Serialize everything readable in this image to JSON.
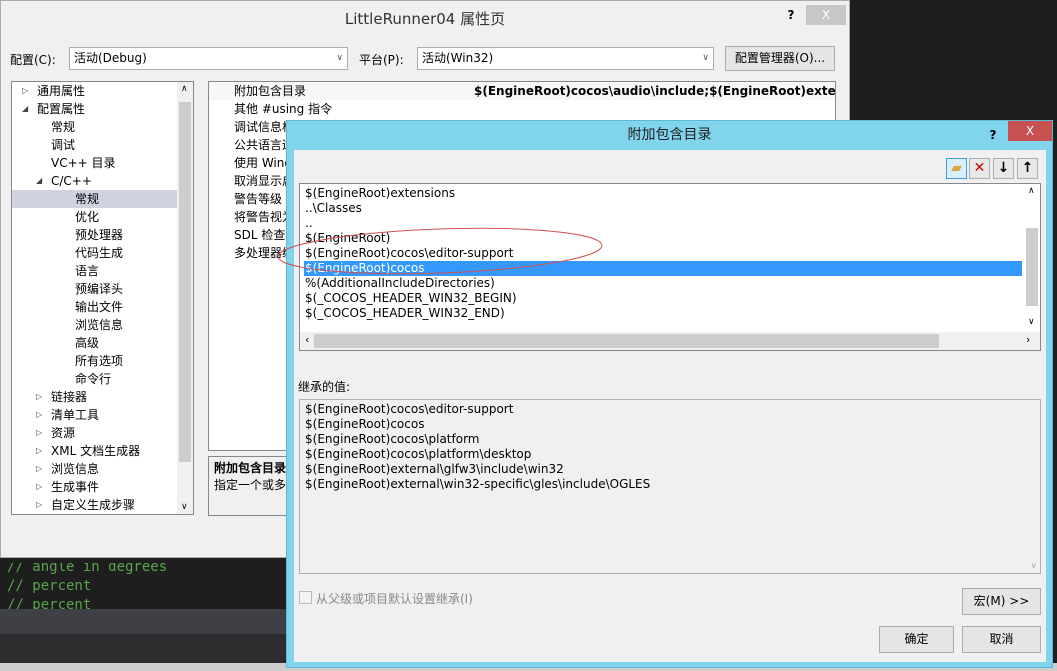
{
  "main": {
    "title": "LittleRunner04 属性页",
    "help": "?",
    "close": "X",
    "config_label": "配置(C):",
    "config_value": "活动(Debug)",
    "platform_label": "平台(P):",
    "platform_value": "活动(Win32)",
    "config_manager": "配置管理器(O)...",
    "tree": [
      {
        "label": "通用属性",
        "level": 0,
        "exp": "▷"
      },
      {
        "label": "配置属性",
        "level": 0,
        "exp": "◢"
      },
      {
        "label": "常规",
        "level": 1
      },
      {
        "label": "调试",
        "level": 1
      },
      {
        "label": "VC++ 目录",
        "level": 1
      },
      {
        "label": "C/C++",
        "level": 1,
        "exp": "◢"
      },
      {
        "label": "常规",
        "level": 2,
        "selected": true
      },
      {
        "label": "优化",
        "level": 2
      },
      {
        "label": "预处理器",
        "level": 2
      },
      {
        "label": "代码生成",
        "level": 2
      },
      {
        "label": "语言",
        "level": 2
      },
      {
        "label": "预编译头",
        "level": 2
      },
      {
        "label": "输出文件",
        "level": 2
      },
      {
        "label": "浏览信息",
        "level": 2
      },
      {
        "label": "高级",
        "level": 2
      },
      {
        "label": "所有选项",
        "level": 2
      },
      {
        "label": "命令行",
        "level": 2
      },
      {
        "label": "链接器",
        "level": 1,
        "exp": "▷"
      },
      {
        "label": "清单工具",
        "level": 1,
        "exp": "▷"
      },
      {
        "label": "资源",
        "level": 1,
        "exp": "▷"
      },
      {
        "label": "XML 文档生成器",
        "level": 1,
        "exp": "▷"
      },
      {
        "label": "浏览信息",
        "level": 1,
        "exp": "▷"
      },
      {
        "label": "生成事件",
        "level": 1,
        "exp": "▷"
      },
      {
        "label": "自定义生成步骤",
        "level": 1,
        "exp": "▷"
      }
    ],
    "grid": [
      {
        "key": "附加包含目录",
        "value": "$(EngineRoot)cocos\\audio\\include;$(EngineRoot)external;$"
      },
      {
        "key": "其他 #using 指令",
        "value": ""
      },
      {
        "key": "调试信息格",
        "value": ""
      },
      {
        "key": "公共语言运",
        "value": ""
      },
      {
        "key": "使用 Wind",
        "value": ""
      },
      {
        "key": "取消显示启",
        "value": ""
      },
      {
        "key": "警告等级",
        "value": ""
      },
      {
        "key": "将警告视为",
        "value": ""
      },
      {
        "key": "SDL 检查",
        "value": ""
      },
      {
        "key": "多处理器编",
        "value": ""
      }
    ],
    "desc_title": "附加包含目录",
    "desc_text": "指定一个或多"
  },
  "code": [
    "// angle in degrees",
    "// percent",
    "// percent"
  ],
  "dialog": {
    "title": "附加包含目录",
    "help": "?",
    "close": "X",
    "items": [
      "$(EngineRoot)extensions",
      "..\\Classes",
      "..",
      "$(EngineRoot)",
      "$(EngineRoot)cocos\\editor-support",
      "$(EngineRoot)cocos",
      "%(AdditionalIncludeDirectories)",
      "$(_COCOS_HEADER_WIN32_BEGIN)",
      "$(_COCOS_HEADER_WIN32_END)"
    ],
    "selected_index": 5,
    "inherited_label": "继承的值:",
    "inherited": [
      "$(EngineRoot)cocos\\editor-support",
      "$(EngineRoot)cocos",
      "$(EngineRoot)cocos\\platform",
      "$(EngineRoot)cocos\\platform\\desktop",
      "$(EngineRoot)external\\glfw3\\include\\win32",
      "$(EngineRoot)external\\win32-specific\\gles\\include\\OGLES"
    ],
    "inherit_checkbox": "从父级或项目默认设置继承(I)",
    "macro": "宏(M) >>",
    "ok": "确定",
    "cancel": "取消"
  }
}
